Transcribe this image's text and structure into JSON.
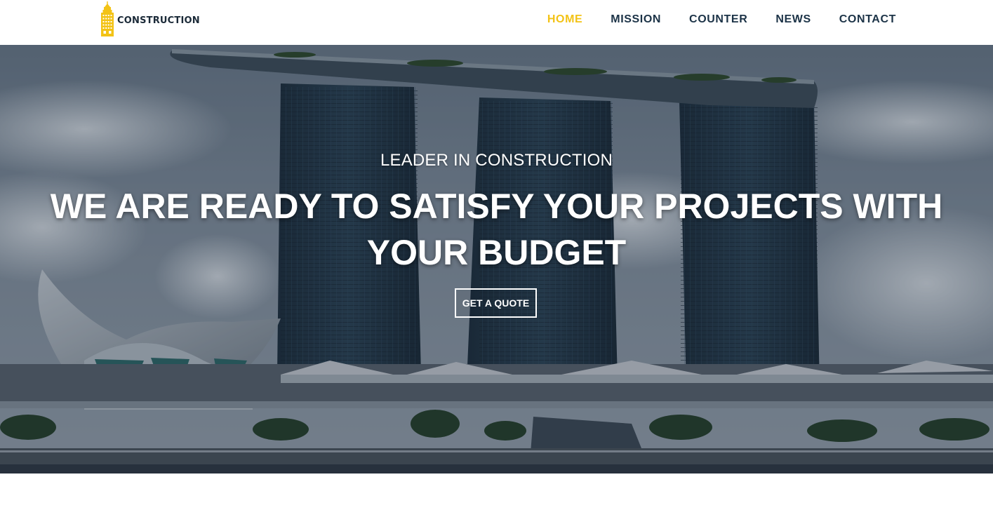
{
  "brand": {
    "name": "CONSTRUCTION",
    "icon": "building-icon",
    "color": "#f3c316"
  },
  "nav": {
    "items": [
      {
        "label": "HOME",
        "active": true
      },
      {
        "label": "MISSION",
        "active": false
      },
      {
        "label": "COUNTER",
        "active": false
      },
      {
        "label": "NEWS",
        "active": false
      },
      {
        "label": "CONTACT",
        "active": false
      }
    ],
    "active_color": "#f3c316",
    "text_color": "#1c3347"
  },
  "hero": {
    "kicker": "LEADER IN CONSTRUCTION",
    "title": "WE ARE READY TO SATISFY YOUR PROJECTS WITH YOUR BUDGET",
    "cta_label": "GET A QUOTE",
    "background": "marina-bay-sands-skyline-photo"
  }
}
